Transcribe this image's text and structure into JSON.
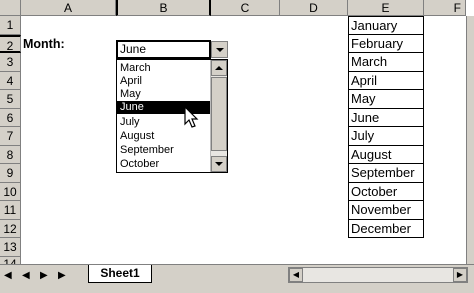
{
  "columns": [
    "A",
    "B",
    "C",
    "D",
    "E",
    "F"
  ],
  "rows": [
    "1",
    "2",
    "3",
    "4",
    "5",
    "6",
    "7",
    "8",
    "9",
    "10",
    "11",
    "12",
    "13",
    "14"
  ],
  "label": "Month:",
  "combo": {
    "value": "June",
    "options": [
      "March",
      "April",
      "May",
      "June",
      "July",
      "August",
      "September",
      "October"
    ],
    "selected": "June"
  },
  "months": [
    "January",
    "February",
    "March",
    "April",
    "May",
    "June",
    "July",
    "August",
    "September",
    "October",
    "November",
    "December"
  ],
  "sheet": {
    "tab": "Sheet1"
  }
}
